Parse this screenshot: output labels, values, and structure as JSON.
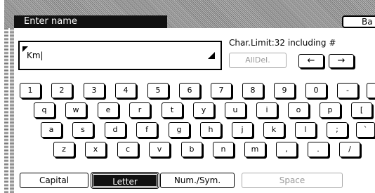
{
  "header": {
    "title": "Enter name",
    "back_label": "Ba"
  },
  "input": {
    "value": "Km|"
  },
  "limits": {
    "char_limit_text": "Char.Limit:32 including #"
  },
  "controls": {
    "alldel_label": "AllDel.",
    "left_arrow": "←",
    "right_arrow": "→"
  },
  "keyboard": {
    "row1": [
      "1",
      "2",
      "3",
      "4",
      "5",
      "6",
      "7",
      "8",
      "9",
      "0",
      "-",
      ""
    ],
    "row2": [
      "q",
      "w",
      "e",
      "r",
      "t",
      "y",
      "u",
      "i",
      "o",
      "p",
      "["
    ],
    "row3": [
      "a",
      "s",
      "d",
      "f",
      "g",
      "h",
      "j",
      "k",
      "l",
      ";",
      "`"
    ],
    "row4": [
      "z",
      "x",
      "c",
      "v",
      "b",
      "n",
      "m",
      ",",
      ".",
      "/"
    ]
  },
  "modes": {
    "capital": "Capital",
    "letter": "Letter",
    "numsym": "Num./Sym.",
    "space": "Space"
  }
}
